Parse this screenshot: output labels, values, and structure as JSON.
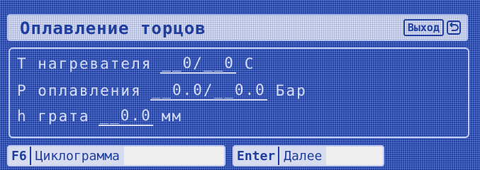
{
  "header": {
    "title": "Оплавление торцов",
    "exit_label": "Выход"
  },
  "params": [
    {
      "label": "T нагревателя",
      "value": "__0/__0",
      "unit": "C"
    },
    {
      "label": "P оплавления",
      "value": "__0.0/__0.0",
      "unit": "Бар"
    },
    {
      "label": "h грата",
      "value": "__0.0",
      "unit": "мм"
    }
  ],
  "softkeys": {
    "f6_key": "F6",
    "f6_label": "Циклограмма",
    "enter_key": "Enter",
    "enter_label": "Далее"
  }
}
